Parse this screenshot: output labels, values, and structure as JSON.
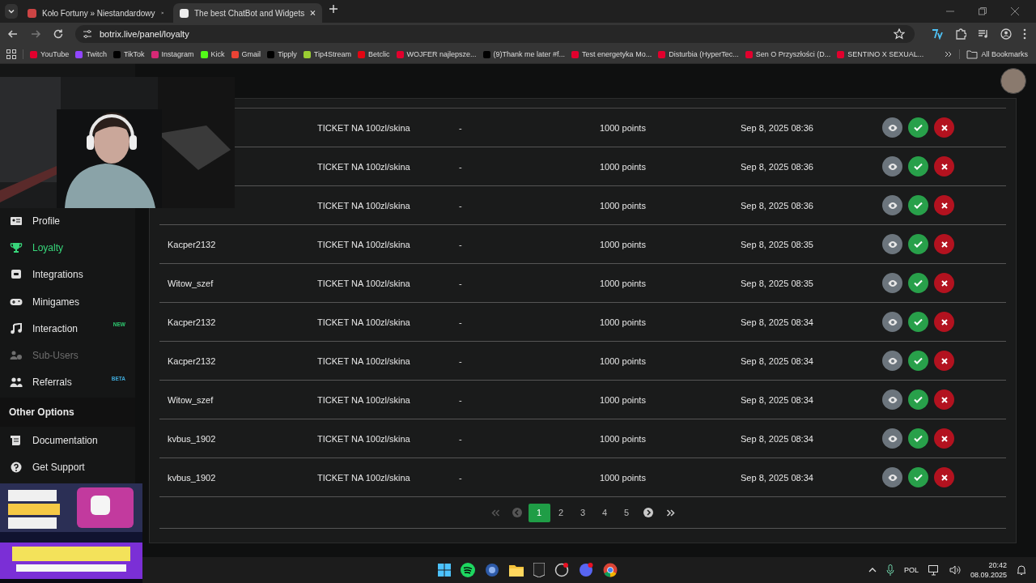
{
  "browser": {
    "tabs": [
      {
        "title": "Koło Fortuny » Niestandardowy",
        "selected": false
      },
      {
        "title": "The best ChatBot and Widgets",
        "selected": true
      }
    ],
    "url": "botrix.live/panel/loyalty",
    "bookmarks": [
      {
        "label": "YouTube",
        "color": "#e1002d"
      },
      {
        "label": "Twitch",
        "color": "#9146ff"
      },
      {
        "label": "TikTok",
        "color": "#000000"
      },
      {
        "label": "Instagram",
        "color": "#d62976"
      },
      {
        "label": "Kick",
        "color": "#53fc18"
      },
      {
        "label": "Gmail",
        "color": "#ea4335"
      },
      {
        "label": "Tipply",
        "color": "#000000"
      },
      {
        "label": "Tip4Stream",
        "color": "#9acd32"
      },
      {
        "label": "Betclic",
        "color": "#e30613"
      },
      {
        "label": "WOJFER najlepsze...",
        "color": "#e1002d"
      },
      {
        "label": "(9)Thank me later #f...",
        "color": "#000000"
      },
      {
        "label": "Test energetyka Mo...",
        "color": "#e1002d"
      },
      {
        "label": "Disturbia (HyperTec...",
        "color": "#e1002d"
      },
      {
        "label": "Sen O Przyszłości (D...",
        "color": "#e1002d"
      },
      {
        "label": "SENTINO X SEXUAL...",
        "color": "#e1002d"
      }
    ],
    "all_bookmarks": "All Bookmarks"
  },
  "sidebar": {
    "items": [
      {
        "kind": "profile",
        "label": "Profile",
        "selected": false,
        "disabled": false
      },
      {
        "kind": "trophy",
        "label": "Loyalty",
        "selected": true,
        "disabled": false
      },
      {
        "kind": "integrations",
        "label": "Integrations",
        "selected": false,
        "disabled": false
      },
      {
        "kind": "gamepad",
        "label": "Minigames",
        "selected": false,
        "disabled": false
      },
      {
        "kind": "music",
        "label": "Interaction",
        "selected": false,
        "disabled": false,
        "badge": "NEW",
        "color": "#2ecc71"
      },
      {
        "kind": "users-cog",
        "label": "Sub-Users",
        "selected": false,
        "disabled": true
      },
      {
        "kind": "users",
        "label": "Referrals",
        "selected": false,
        "disabled": false,
        "badge": "BETA",
        "color": "#3fa9d9"
      }
    ],
    "section": "Other Options",
    "other_items": [
      {
        "kind": "scroll",
        "label": "Documentation"
      },
      {
        "kind": "help",
        "label": "Get Support"
      }
    ]
  },
  "table": {
    "rows": [
      {
        "reward": "TICKET NA 100zl/skina",
        "input": "-",
        "cost": "1000 points",
        "date": "Sep 8, 2025 08:36"
      },
      {
        "reward": "TICKET NA 100zl/skina",
        "input": "-",
        "cost": "1000 points",
        "date": "Sep 8, 2025 08:36"
      },
      {
        "reward": "TICKET NA 100zl/skina",
        "input": "-",
        "cost": "1000 points",
        "date": "Sep 8, 2025 08:36"
      },
      {
        "user": "Kacper2132",
        "reward": "TICKET NA 100zl/skina",
        "input": "-",
        "cost": "1000 points",
        "date": "Sep 8, 2025 08:35"
      },
      {
        "user": "Witow_szef",
        "reward": "TICKET NA 100zl/skina",
        "input": "-",
        "cost": "1000 points",
        "date": "Sep 8, 2025 08:35"
      },
      {
        "user": "Kacper2132",
        "reward": "TICKET NA 100zl/skina",
        "input": "-",
        "cost": "1000 points",
        "date": "Sep 8, 2025 08:34"
      },
      {
        "user": "Kacper2132",
        "reward": "TICKET NA 100zl/skina",
        "input": "-",
        "cost": "1000 points",
        "date": "Sep 8, 2025 08:34"
      },
      {
        "user": "Witow_szef",
        "reward": "TICKET NA 100zl/skina",
        "input": "-",
        "cost": "1000 points",
        "date": "Sep 8, 2025 08:34"
      },
      {
        "user": "kvbus_1902",
        "reward": "TICKET NA 100zl/skina",
        "input": "-",
        "cost": "1000 points",
        "date": "Sep 8, 2025 08:34"
      },
      {
        "user": "kvbus_1902",
        "reward": "TICKET NA 100zl/skina",
        "input": "-",
        "cost": "1000 points",
        "date": "Sep 8, 2025 08:34"
      }
    ]
  },
  "pagination": {
    "first_disabled": true,
    "prev_disabled": true,
    "pages": [
      {
        "label": "1",
        "selected": true
      },
      {
        "label": "2",
        "selected": false
      },
      {
        "label": "3",
        "selected": false
      },
      {
        "label": "4",
        "selected": false
      },
      {
        "label": "5",
        "selected": false
      }
    ]
  },
  "taskbar": {
    "language": "POL",
    "time": "20:42",
    "date": "08.09.2025"
  }
}
